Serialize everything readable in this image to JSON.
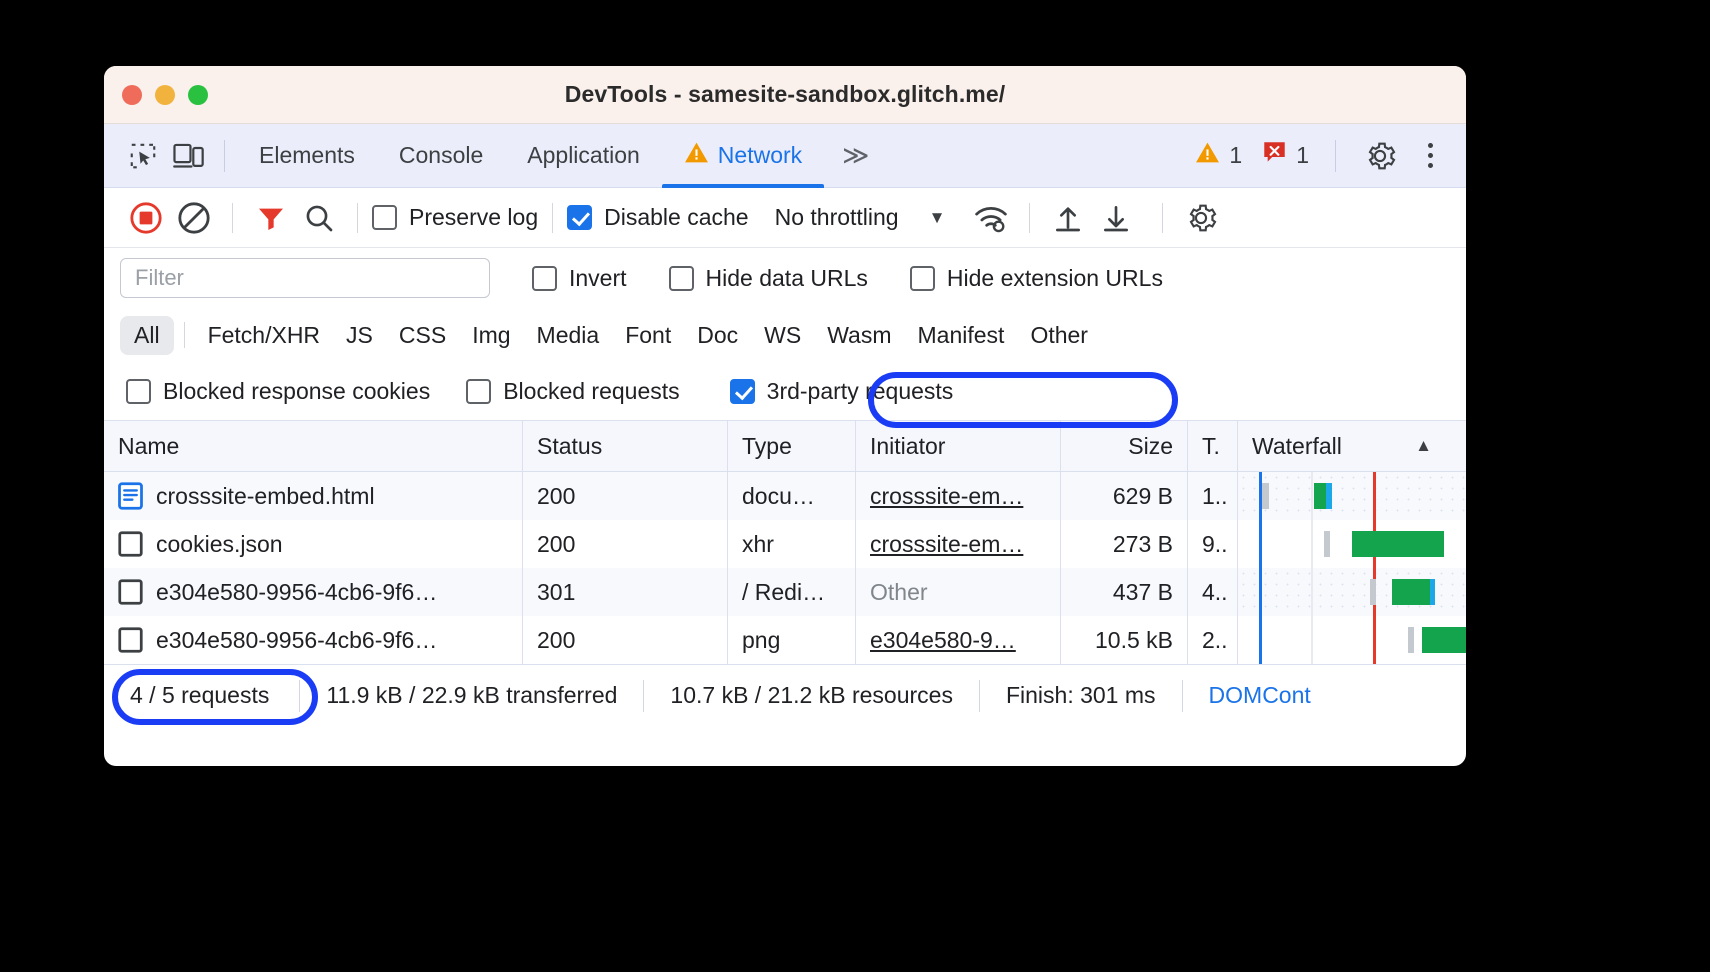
{
  "window": {
    "title": "DevTools - samesite-sandbox.glitch.me/",
    "traffic_lights": [
      "close",
      "minimize",
      "zoom"
    ]
  },
  "panel_tabs": {
    "icons": [
      "inspect-element-icon",
      "device-toolbar-icon"
    ],
    "items": [
      {
        "label": "Elements",
        "active": false,
        "warning": false
      },
      {
        "label": "Console",
        "active": false,
        "warning": false
      },
      {
        "label": "Application",
        "active": false,
        "warning": false
      },
      {
        "label": "Network",
        "active": true,
        "warning": true
      }
    ],
    "more_label": "≫",
    "warning_count": "1",
    "error_count": "1"
  },
  "network_toolbar": {
    "record_label": "record-button",
    "clear_label": "clear-button",
    "filter_label": "filter-button",
    "search_label": "search-button",
    "preserve_log": {
      "label": "Preserve log",
      "checked": false
    },
    "disable_cache": {
      "label": "Disable cache",
      "checked": true
    },
    "throttling": {
      "value": "No throttling",
      "caret": "▼"
    },
    "wifi_label": "network-conditions-button",
    "import_label": "import-har-button",
    "export_label": "export-har-button",
    "settings_label": "network-settings-button"
  },
  "filter_row": {
    "filter_placeholder": "Filter",
    "filter_value": "",
    "invert": {
      "label": "Invert",
      "checked": false
    },
    "hide_data_urls": {
      "label": "Hide data URLs",
      "checked": false
    },
    "hide_extension_urls": {
      "label": "Hide extension URLs",
      "checked": false
    }
  },
  "type_filters": {
    "all": "All",
    "items": [
      "Fetch/XHR",
      "JS",
      "CSS",
      "Img",
      "Media",
      "Font",
      "Doc",
      "WS",
      "Wasm",
      "Manifest",
      "Other"
    ],
    "selected": "All"
  },
  "request_filters": [
    {
      "label": "Blocked response cookies",
      "checked": false,
      "highlighted": false
    },
    {
      "label": "Blocked requests",
      "checked": false,
      "highlighted": false
    },
    {
      "label": "3rd-party requests",
      "checked": true,
      "highlighted": true
    }
  ],
  "table": {
    "columns": [
      "Name",
      "Status",
      "Type",
      "Initiator",
      "Size",
      "T.",
      "Waterfall"
    ],
    "sort_indicator": "▲",
    "rows": [
      {
        "icon": "document-icon",
        "name": "crosssite-embed.html",
        "status": "200",
        "type": "docu…",
        "initiator": "crosssite-em…",
        "initiator_link": true,
        "size": "629 B",
        "time": "1..",
        "selected": false
      },
      {
        "icon": "generic-file-icon",
        "name": "cookies.json",
        "status": "200",
        "type": "xhr",
        "initiator": "crosssite-em…",
        "initiator_link": true,
        "size": "273 B",
        "time": "9..",
        "selected": false
      },
      {
        "icon": "generic-file-icon",
        "name": "e304e580-9956-4cb6-9f6…",
        "status": "301",
        "type": "/ Redi…",
        "initiator": "Other",
        "initiator_link": false,
        "size": "437 B",
        "time": "4..",
        "selected": false
      },
      {
        "icon": "generic-file-icon",
        "name": "e304e580-9956-4cb6-9f6…",
        "status": "200",
        "type": "png",
        "initiator": "e304e580-9…",
        "initiator_link": true,
        "size": "10.5 kB",
        "time": "2..",
        "selected": false
      }
    ]
  },
  "footer": {
    "requests": "4 / 5 requests",
    "transferred": "11.9 kB / 22.9 kB transferred",
    "resources": "10.7 kB / 21.2 kB resources",
    "finish": "Finish: 301 ms",
    "domcontentloaded": "DOMCont"
  },
  "colors": {
    "accent_blue": "#1a73e8",
    "annotation_blue": "#1b3cf5",
    "warning_orange": "#f29900",
    "error_red": "#d93025",
    "waterfall_green": "#14a44d",
    "waterfall_blue": "#1ba7e8",
    "record_red": "#e5392b"
  }
}
